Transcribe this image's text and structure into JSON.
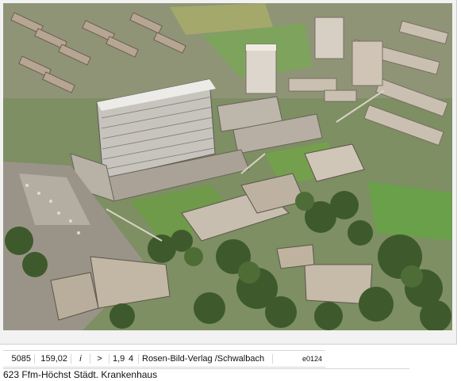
{
  "listing": {
    "id": "5085",
    "price": "159,02",
    "info_glyph": "i",
    "arrow_glyph": ">",
    "num_a": "1,9",
    "num_b": "4",
    "publisher": "Rosen-Bild-Verlag /Schwalbach",
    "code": "e0124"
  },
  "caption": "623 Ffm-Höchst  Städt. Krankenhaus",
  "colors": {
    "background": "#ffffff",
    "photo_frame": "#f2f2f2",
    "text": "#111111"
  }
}
